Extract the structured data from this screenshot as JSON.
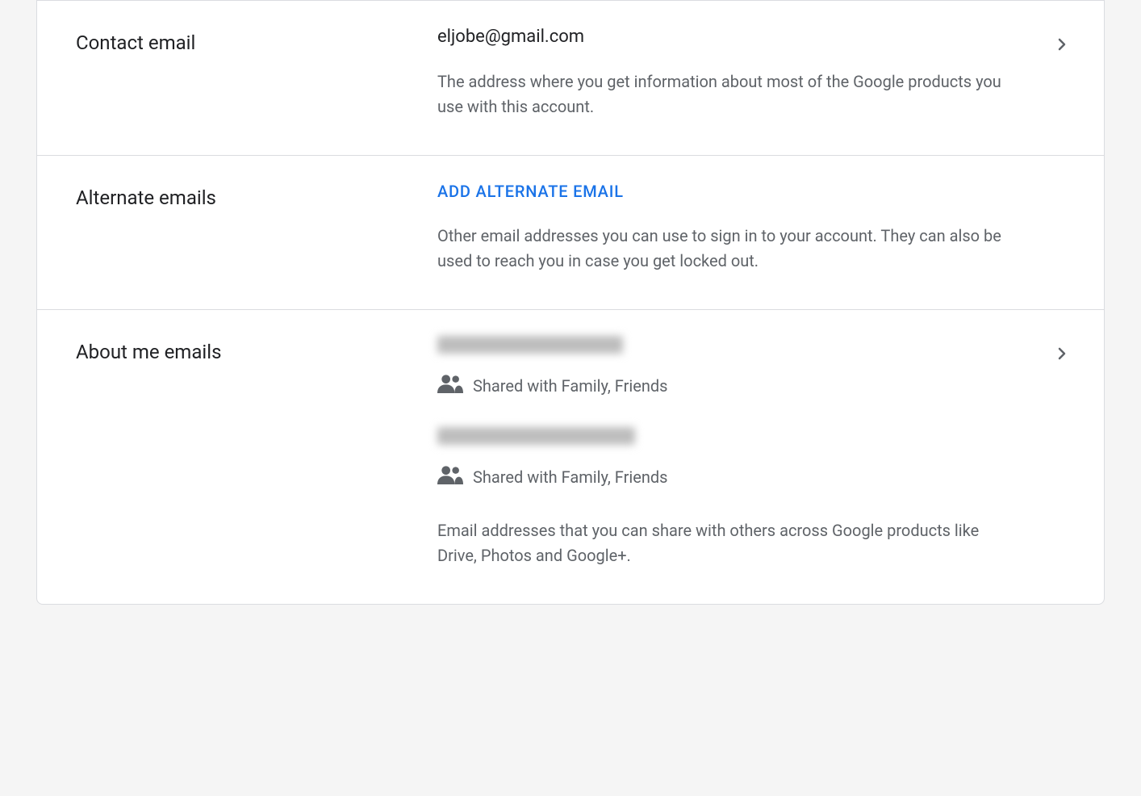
{
  "contact_email": {
    "label": "Contact email",
    "value": "eljobe@gmail.com",
    "description": "The address where you get information about most of the Google products you use with this account."
  },
  "alternate_emails": {
    "label": "Alternate emails",
    "action": "Add Alternate Email",
    "description": "Other email addresses you can use to sign in to your account. They can also be used to reach you in case you get locked out."
  },
  "about_me": {
    "label": "About me emails",
    "shared_text_1": "Shared with Family, Friends",
    "shared_text_2": "Shared with Family, Friends",
    "description": "Email addresses that you can share with others across Google products like Drive, Photos and Google+."
  }
}
